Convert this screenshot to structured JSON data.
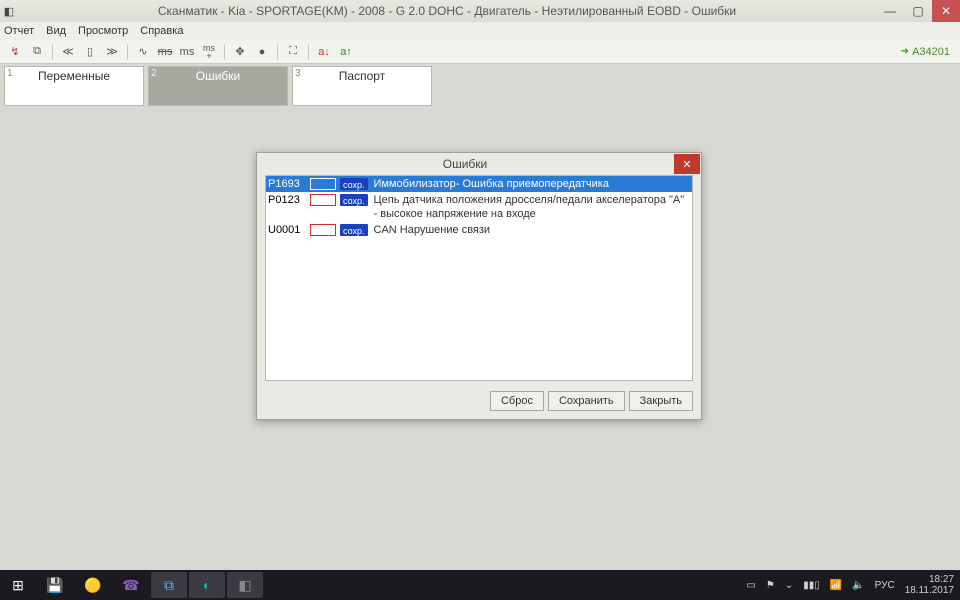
{
  "window": {
    "title": "Сканматик - Kia - SPORTAGE(KM) - 2008 - G 2.0 DOHC - Двигатель - Неэтилированный EOBD - Ошибки"
  },
  "menu": {
    "items": [
      "Отчет",
      "Вид",
      "Просмотр",
      "Справка"
    ]
  },
  "toolbar": {
    "session_id": "A34201",
    "icons": [
      "↯",
      "⧉",
      "≪",
      "▯",
      "≫",
      "∿",
      "ms",
      "ms",
      "ms+",
      "✥",
      "●",
      "⛶",
      "a↓",
      "a↑"
    ]
  },
  "tabs": [
    {
      "num": "1",
      "label": "Переменные",
      "active": false
    },
    {
      "num": "2",
      "label": "Ошибки",
      "active": true
    },
    {
      "num": "3",
      "label": "Паспорт",
      "active": false
    }
  ],
  "dialog": {
    "title": "Ошибки",
    "errors": [
      {
        "code": "P1693",
        "store": "сохр.",
        "desc": "Иммобилизатор- Ошибка приемопередатчика",
        "selected": true
      },
      {
        "code": "P0123",
        "store": "сохр.",
        "desc": "Цепь датчика положения дросселя/педали акселератора \"A\" - высокое напряжение на входе",
        "selected": false
      },
      {
        "code": "U0001",
        "store": "сохр.",
        "desc": "CAN Нарушение связи",
        "selected": false
      }
    ],
    "buttons": {
      "reset": "Сброс",
      "save": "Сохранить",
      "close": "Закрыть"
    }
  },
  "taskbar": {
    "lang": "РУС",
    "time": "18:27",
    "date": "18.11.2017"
  }
}
